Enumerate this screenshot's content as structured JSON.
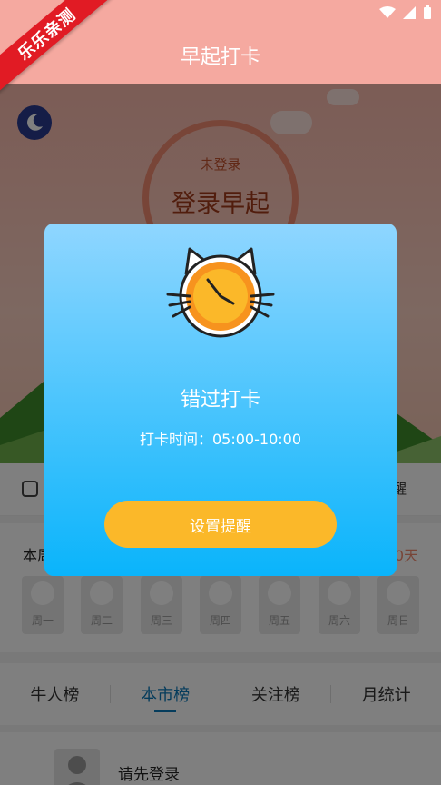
{
  "app": {
    "title": "早起打卡",
    "corner_banner": "乐乐亲测"
  },
  "hero": {
    "status": "未登录",
    "action": "登录早起"
  },
  "toolbar": {
    "right_text": "醒"
  },
  "week": {
    "title": "本周",
    "days_suffix": "0天",
    "days": [
      "周一",
      "周二",
      "周三",
      "周四",
      "周五",
      "周六",
      "周日"
    ]
  },
  "tabs": [
    {
      "label": "牛人榜"
    },
    {
      "label": "本市榜"
    },
    {
      "label": "关注榜"
    },
    {
      "label": "月统计"
    }
  ],
  "login_prompt": "请先登录",
  "modal": {
    "title": "错过打卡",
    "subtitle": "打卡时间：05:00-10:00",
    "button_label": "设置提醒"
  },
  "colors": {
    "header": "#f5a9a0",
    "modal_top": "#8fd6ff",
    "modal_bottom": "#0ab4fb",
    "button": "#fbb829",
    "active_tab": "#0b78b8"
  }
}
